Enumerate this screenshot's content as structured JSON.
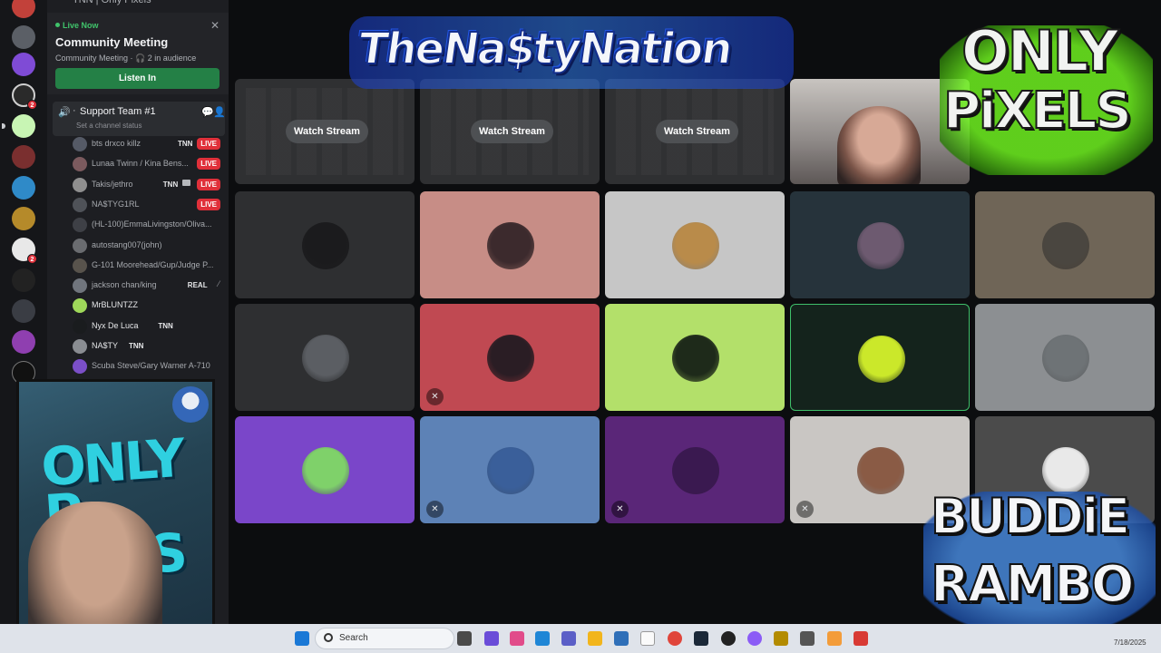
{
  "sidebar": {
    "top_partial_text": "TNN | Only Pixels",
    "live_card": {
      "status": "Live Now",
      "title": "Community Meeting",
      "subtitle": "Community Meeting · 🎧 2 in audience",
      "button": "Listen In"
    },
    "channel": {
      "name": "Support Team #1",
      "status_placeholder": "Set a channel status"
    },
    "members": [
      {
        "name": "bts drxco killz",
        "tag": "TNN",
        "live": "LIVE",
        "color": "#555a66"
      },
      {
        "name": "Lunaa Twinn / Kina Bens...",
        "tag": "",
        "live": "LIVE",
        "color": "#7b5a5e"
      },
      {
        "name": "Takis/jethro",
        "tag": "TNN",
        "live": "LIVE",
        "color": "#8f8f8f"
      },
      {
        "name": "NA$TYG1RL",
        "tag": "",
        "live": "LIVE",
        "color": "#4f5258"
      },
      {
        "name": "(HL-100)EmmaLivingston/Oliva...",
        "tag": "",
        "live": "",
        "color": "#3e4046"
      },
      {
        "name": "autostang007(john)",
        "tag": "",
        "live": "",
        "color": "#6a6c70"
      },
      {
        "name": "G-101 Moorehead/Gup/Judge P...",
        "tag": "",
        "live": "",
        "color": "#58534c"
      },
      {
        "name": "jackson chan/king",
        "tag": "REAL",
        "live": "",
        "color": "#70757d"
      },
      {
        "name": "MrBLUNTZZ",
        "tag": "",
        "live": "",
        "color": "#9fd85a"
      },
      {
        "name": "Nyx De Luca",
        "tag": "TNN",
        "live": "",
        "color": "#1a1c1e"
      },
      {
        "name": "NA$TY",
        "tag": "TNN",
        "live": "",
        "color": "#8a8d92"
      },
      {
        "name": "Scuba Steve/Gary Warner A-710",
        "tag": "",
        "live": "",
        "color": "#7b4fc8"
      }
    ]
  },
  "streams": [
    {
      "label": "Watch Stream"
    },
    {
      "label": "Watch Stream"
    },
    {
      "label": "Watch Stream"
    }
  ],
  "tiles": [
    {
      "bg": "#2e2f31",
      "avatar": "#1b1b1d",
      "muted": false
    },
    {
      "bg": "#c78d86",
      "avatar": "#3c2a2d",
      "muted": false
    },
    {
      "bg": "#c6c6c6",
      "avatar": "#b98b4a",
      "muted": false
    },
    {
      "bg": "#26333b",
      "avatar": "#6d5a70",
      "muted": false
    },
    {
      "bg": "#6f6557",
      "avatar": "#4a4640",
      "muted": false
    },
    {
      "bg": "#2e2f31",
      "avatar": "#5b5e63",
      "muted": false
    },
    {
      "bg": "#c04952",
      "avatar": "#2a1d24",
      "muted": true
    },
    {
      "bg": "#b3e06a",
      "avatar": "#1e2a1a",
      "muted": false
    },
    {
      "bg": "#14231c",
      "avatar": "#cbe82a",
      "muted": false
    },
    {
      "bg": "#8c8f92",
      "avatar": "#6e7376",
      "muted": false
    },
    {
      "bg": "#7a46c9",
      "avatar": "#7fd16a",
      "muted": false
    },
    {
      "bg": "#5d82b6",
      "avatar": "#3a5f9a",
      "muted": true
    },
    {
      "bg": "#5a2678",
      "avatar": "#3a1950",
      "muted": true
    },
    {
      "bg": "#c9c6c3",
      "avatar": "#8a5b45",
      "muted": true
    },
    {
      "bg": "#4b4b4b",
      "avatar": "#e9e9e9",
      "muted": false
    }
  ],
  "overlay": {
    "top_logo": "TheNa$tyNation",
    "pixels_line1": "ONLY",
    "pixels_line2": "PiXELS",
    "buddie_line1": "BUDDiE",
    "buddie_line2": "RAMBO",
    "webcam_logo_line1": "ONLY",
    "webcam_logo_line2": "P  XELS"
  },
  "taskbar": {
    "search_label": "Search",
    "date": "7/18/2025"
  },
  "colors": {
    "accent_green": "#248046",
    "live_red": "#e0303a",
    "sidebar_bg": "#1d1e22",
    "grid_bg": "#0c0d0f"
  }
}
